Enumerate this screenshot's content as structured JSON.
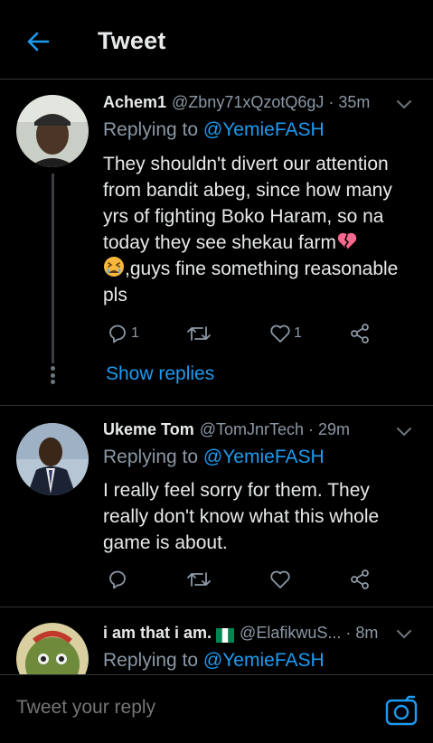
{
  "header": {
    "title": "Tweet"
  },
  "tweets": [
    {
      "name": "Achem1",
      "handle": "@Zbny71xQzotQ6gJ",
      "separator": "·",
      "time": "35m",
      "reply_prefix": "Replying to",
      "reply_mention": "@YemieFASH",
      "lines": [
        "They shouldn't divert our attention",
        "from bandit abeg, since how many",
        "yrs of fighting Boko Haram, so na",
        "today they see shekau farm",
        ",guys fine something reasonable",
        "pls"
      ],
      "emojis": [
        "broken-heart-icon",
        "tired-face-icon"
      ],
      "reply_count": "1",
      "retweet_count": "",
      "like_count": "1",
      "show_replies": "Show replies"
    },
    {
      "name": "Ukeme Tom",
      "handle": "@TomJnrTech",
      "separator": "·",
      "time": "29m",
      "reply_prefix": "Replying to",
      "reply_mention": "@YemieFASH",
      "lines": [
        "I really feel sorry for them. They",
        "really don't know what this whole",
        "game is about."
      ],
      "reply_count": "",
      "retweet_count": "",
      "like_count": ""
    },
    {
      "name": "i am that i am.",
      "flag": "nigeria-flag-icon",
      "handle": "@ElafikwuS...",
      "separator": "·",
      "time": "8m",
      "reply_prefix": "Replying to",
      "reply_mention": "@YemieFASH"
    }
  ],
  "composer": {
    "placeholder": "Tweet your reply"
  },
  "colors": {
    "accent": "#1d9bf0",
    "background": "#000000",
    "secondary_text": "#8b98a5",
    "border": "#2f3336"
  }
}
